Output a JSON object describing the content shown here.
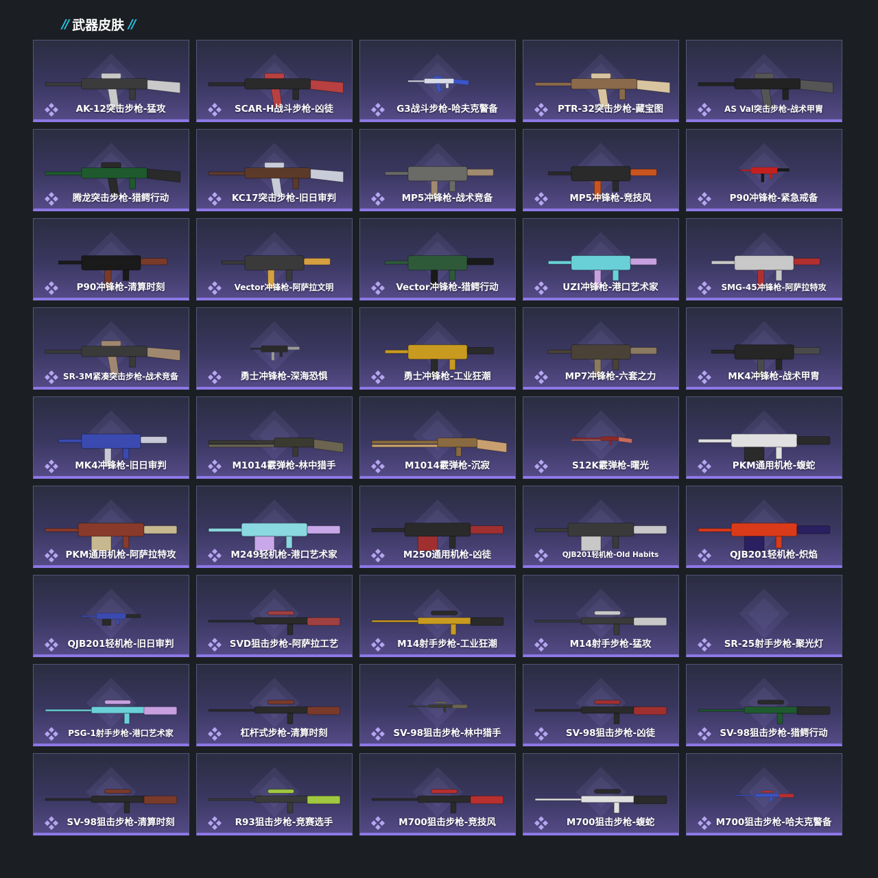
{
  "header": {
    "title": "武器皮肤",
    "decor": "//"
  },
  "colors": {
    "accent": "#8d78e6",
    "slash": "#27c6e6",
    "card_top": "#2b2d41",
    "card_bottom": "#544a86"
  },
  "cards": [
    {
      "label": "AK-12突击步枪-猛攻",
      "icon": "rifle-skin-icon",
      "tone": [
        "#3b3b3b",
        "#c9c9c9"
      ]
    },
    {
      "label": "SCAR-H战斗步枪-凶徒",
      "icon": "rifle-skin-icon",
      "tone": [
        "#2a2a2a",
        "#b84040"
      ]
    },
    {
      "label": "G3战斗步枪-哈夫克警备",
      "icon": "rifle-skin-icon",
      "tone": [
        "#d9dbe8",
        "#3a55c8"
      ]
    },
    {
      "label": "PTR-32突击步枪-藏宝图",
      "icon": "rifle-skin-icon",
      "tone": [
        "#8a6a4a",
        "#d8c4a0"
      ]
    },
    {
      "label": "AS Val突击步枪-战术甲胄",
      "icon": "rifle-skin-icon",
      "tone": [
        "#222222",
        "#555555"
      ]
    },
    {
      "label": "腾龙突击步枪-猎鳄行动",
      "icon": "rifle-skin-icon",
      "tone": [
        "#1e5a2e",
        "#2a2a2a"
      ]
    },
    {
      "label": "KC17突击步枪-旧日审判",
      "icon": "rifle-skin-icon",
      "tone": [
        "#5c3a2a",
        "#c8ccd8"
      ]
    },
    {
      "label": "MP5冲锋枪-战术竞备",
      "icon": "smg-skin-icon",
      "tone": [
        "#6a6a66",
        "#a08a70"
      ]
    },
    {
      "label": "MP5冲锋枪-竞技风",
      "icon": "smg-skin-icon",
      "tone": [
        "#2a2a2a",
        "#c8541e"
      ]
    },
    {
      "label": "P90冲锋枪-紧急戒备",
      "icon": "smg-skin-icon",
      "tone": [
        "#c42020",
        "#1a1a1a"
      ]
    },
    {
      "label": "P90冲锋枪-清算时刻",
      "icon": "smg-skin-icon",
      "tone": [
        "#1a1a1a",
        "#7a3a2a"
      ]
    },
    {
      "label": "Vector冲锋枪-阿萨拉文明",
      "icon": "smg-skin-icon",
      "tone": [
        "#3a3a3a",
        "#d6a040"
      ]
    },
    {
      "label": "Vector冲锋枪-猎鳄行动",
      "icon": "smg-skin-icon",
      "tone": [
        "#2e5a3a",
        "#1a1a1a"
      ]
    },
    {
      "label": "UZI冲锋枪-港口艺术家",
      "icon": "smg-skin-icon",
      "tone": [
        "#6ad0d8",
        "#c8a0e0"
      ]
    },
    {
      "label": "SMG-45冲锋枪-阿萨拉特攻",
      "icon": "smg-skin-icon",
      "tone": [
        "#c8c8c8",
        "#b03030"
      ]
    },
    {
      "label": "SR-3M紧凑突击步枪-战术竞备",
      "icon": "rifle-skin-icon",
      "tone": [
        "#3a3a3a",
        "#a08870"
      ]
    },
    {
      "label": "勇士冲锋枪-深海恐惧",
      "icon": "smg-skin-icon",
      "tone": [
        "#2a2a2a",
        "#9a9a9a"
      ]
    },
    {
      "label": "勇士冲锋枪-工业狂潮",
      "icon": "smg-skin-icon",
      "tone": [
        "#c89a20",
        "#2a2a2a"
      ]
    },
    {
      "label": "MP7冲锋枪-六套之力",
      "icon": "smg-skin-icon",
      "tone": [
        "#4a4236",
        "#8a7a60"
      ]
    },
    {
      "label": "MK4冲锋枪-战术甲胄",
      "icon": "smg-skin-icon",
      "tone": [
        "#262626",
        "#4a4a4a"
      ]
    },
    {
      "label": "MK4冲锋枪-旧日审判",
      "icon": "smg-skin-icon",
      "tone": [
        "#3a4ab0",
        "#c8c8d8"
      ]
    },
    {
      "label": "M1014霰弹枪-林中猎手",
      "icon": "shotgun-skin-icon",
      "tone": [
        "#3a3a30",
        "#6a6450"
      ]
    },
    {
      "label": "M1014霰弹枪-沉寂",
      "icon": "shotgun-skin-icon",
      "tone": [
        "#8a6a40",
        "#c8a070"
      ]
    },
    {
      "label": "S12K霰弹枪-曙光",
      "icon": "shotgun-skin-icon",
      "tone": [
        "#8a2a2a",
        "#c86a5a"
      ]
    },
    {
      "label": "PKM通用机枪-蝮蛇",
      "icon": "machinegun-skin-icon",
      "tone": [
        "#e0e0e0",
        "#2a2a2a"
      ]
    },
    {
      "label": "PKM通用机枪-阿萨拉特攻",
      "icon": "machinegun-skin-icon",
      "tone": [
        "#8a3a2a",
        "#c8b890"
      ]
    },
    {
      "label": "M249轻机枪-港口艺术家",
      "icon": "machinegun-skin-icon",
      "tone": [
        "#8ad8e0",
        "#c8a8e8"
      ]
    },
    {
      "label": "M250通用机枪-凶徒",
      "icon": "machinegun-skin-icon",
      "tone": [
        "#2a2a2a",
        "#a03030"
      ]
    },
    {
      "label": "QJB201轻机枪-Old Habits",
      "icon": "machinegun-skin-icon",
      "tone": [
        "#3a3a3a",
        "#c8c8c8"
      ]
    },
    {
      "label": "QJB201轻机枪-炽焰",
      "icon": "machinegun-skin-icon",
      "tone": [
        "#d83a1a",
        "#2a2060"
      ]
    },
    {
      "label": "QJB201轻机枪-旧日审判",
      "icon": "machinegun-skin-icon",
      "tone": [
        "#3a4ab0",
        "#2a2a2a"
      ]
    },
    {
      "label": "SVD狙击步枪-阿萨拉工艺",
      "icon": "sniper-skin-icon",
      "tone": [
        "#2a2a2a",
        "#a04040"
      ]
    },
    {
      "label": "M14射手步枪-工业狂潮",
      "icon": "sniper-skin-icon",
      "tone": [
        "#c89a20",
        "#2a2a2a"
      ]
    },
    {
      "label": "M14射手步枪-猛攻",
      "icon": "sniper-skin-icon",
      "tone": [
        "#3a3a3a",
        "#c8c8c8"
      ]
    },
    {
      "label": "SR-25射手步枪-聚光灯",
      "icon": "sniper-skin-icon",
      "tone": []
    },
    {
      "label": "PSG-1射手步枪-港口艺术家",
      "icon": "sniper-skin-icon",
      "tone": [
        "#6ad0d8",
        "#c8a0e0"
      ]
    },
    {
      "label": "杠杆式步枪-清算时刻",
      "icon": "sniper-skin-icon",
      "tone": [
        "#2a2a2a",
        "#7a3a2a"
      ]
    },
    {
      "label": "SV-98狙击步枪-林中猎手",
      "icon": "sniper-skin-icon",
      "tone": [
        "#3a3a30",
        "#6a6450"
      ]
    },
    {
      "label": "SV-98狙击步枪-凶徒",
      "icon": "sniper-skin-icon",
      "tone": [
        "#2a2a2a",
        "#a03030"
      ]
    },
    {
      "label": "SV-98狙击步枪-猎鳄行动",
      "icon": "sniper-skin-icon",
      "tone": [
        "#1e5a2e",
        "#2a2a2a"
      ]
    },
    {
      "label": "SV-98狙击步枪-清算时刻",
      "icon": "sniper-skin-icon",
      "tone": [
        "#2a2a2a",
        "#7a3a2a"
      ]
    },
    {
      "label": "R93狙击步枪-竞赛选手",
      "icon": "sniper-skin-icon",
      "tone": [
        "#3a3a3a",
        "#a0c840"
      ]
    },
    {
      "label": "M700狙击步枪-竞技风",
      "icon": "sniper-skin-icon",
      "tone": [
        "#2a2a2a",
        "#b83030"
      ]
    },
    {
      "label": "M700狙击步枪-蝮蛇",
      "icon": "sniper-skin-icon",
      "tone": [
        "#e0e0e0",
        "#2a2a2a"
      ]
    },
    {
      "label": "M700狙击步枪-哈夫克警备",
      "icon": "sniper-skin-icon",
      "tone": [
        "#3a55c8",
        "#b83030"
      ]
    }
  ]
}
